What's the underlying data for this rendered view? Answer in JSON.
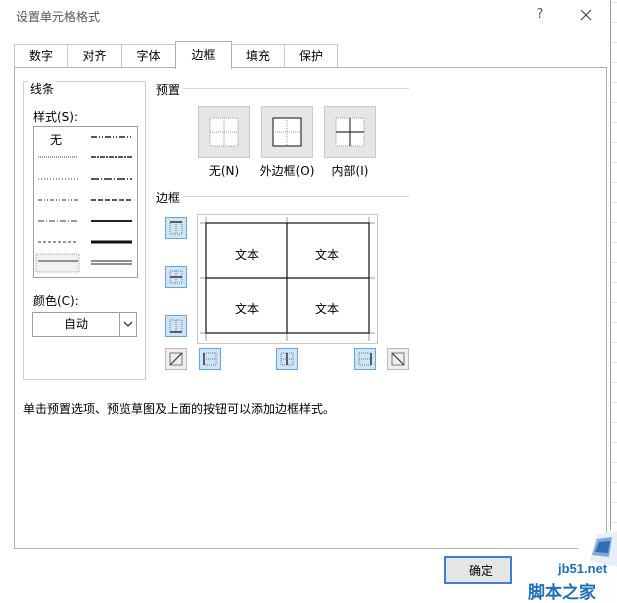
{
  "dialog": {
    "title": "设置单元格格式",
    "help_label": "?"
  },
  "tabs": [
    {
      "label": "数字",
      "active": false
    },
    {
      "label": "对齐",
      "active": false
    },
    {
      "label": "字体",
      "active": false
    },
    {
      "label": "边框",
      "active": true
    },
    {
      "label": "填充",
      "active": false
    },
    {
      "label": "保护",
      "active": false
    }
  ],
  "line": {
    "group_title": "线条",
    "style_label": "样式(S):",
    "none_label": "无",
    "color_label": "颜色(C):",
    "color_value": "自动"
  },
  "presets": {
    "title": "预置",
    "items": [
      {
        "label": "无(N)",
        "icon": "border-none-icon"
      },
      {
        "label": "外边框(O)",
        "icon": "border-outline-icon"
      },
      {
        "label": "内部(I)",
        "icon": "border-inside-icon"
      }
    ]
  },
  "border": {
    "title": "边框",
    "cell_text": "文本",
    "buttons": [
      {
        "name": "border-top-button",
        "active": true
      },
      {
        "name": "border-inner-horizontal-button",
        "active": true
      },
      {
        "name": "border-bottom-button",
        "active": true
      },
      {
        "name": "border-diagonal-up-button",
        "active": false
      },
      {
        "name": "border-left-button",
        "active": true
      },
      {
        "name": "border-inner-vertical-button",
        "active": true
      },
      {
        "name": "border-right-button",
        "active": true
      },
      {
        "name": "border-diagonal-down-button",
        "active": false
      }
    ]
  },
  "hint": "单击预置选项、预览草图及上面的按钮可以添加边框样式。",
  "footer": {
    "ok_label": "确定"
  },
  "watermark": {
    "url": "jb51.net",
    "name": "脚本之家"
  },
  "colors": {
    "active_border_button": "#cde5f7",
    "active_border_button_edge": "#6aa4d8",
    "ok_button_edge": "#3c7fd1",
    "watermark": "#1e6fb7"
  }
}
